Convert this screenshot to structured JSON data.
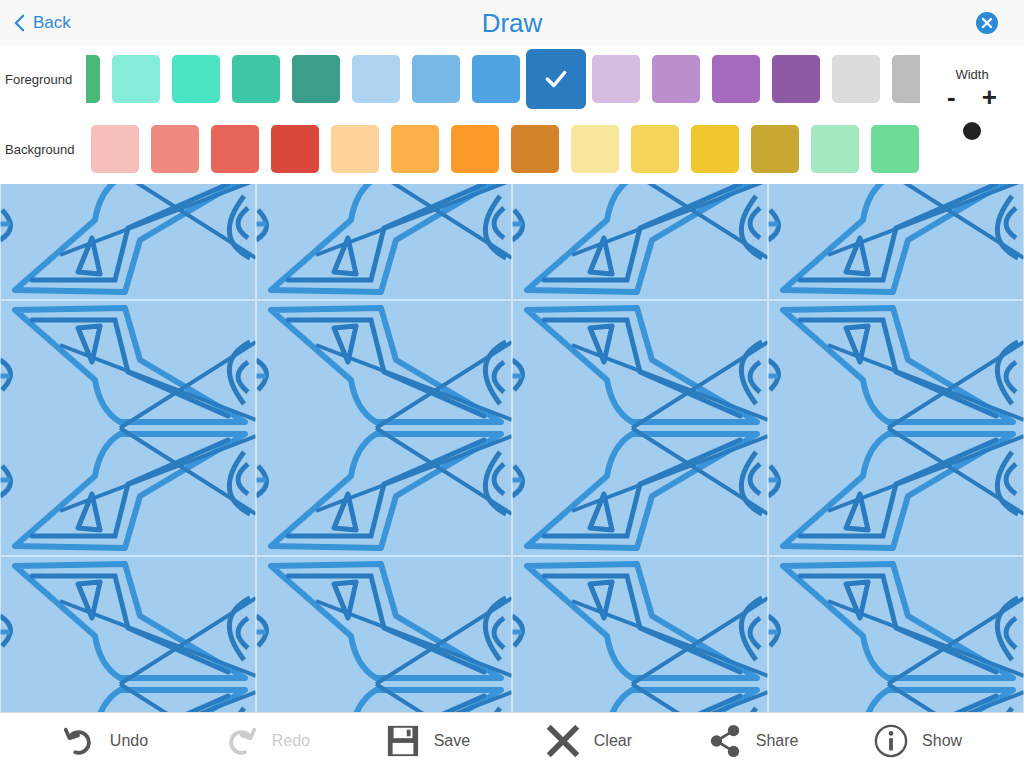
{
  "header": {
    "back": "Back",
    "title": "Draw"
  },
  "palette": {
    "foreground": {
      "label": "Foreground",
      "swatches": [
        {
          "color": "#4bb87a",
          "selected": false
        },
        {
          "color": "#84ecd8",
          "selected": false
        },
        {
          "color": "#4ae4c4",
          "selected": false
        },
        {
          "color": "#3cc6a6",
          "selected": false
        },
        {
          "color": "#3a9e8a",
          "selected": false
        },
        {
          "color": "#aed3f0",
          "selected": false
        },
        {
          "color": "#78b8e6",
          "selected": false
        },
        {
          "color": "#4fa3e0",
          "selected": false
        },
        {
          "color": "#2a7bbf",
          "selected": true
        },
        {
          "color": "#d7bde2",
          "selected": false
        },
        {
          "color": "#bb8fce",
          "selected": false
        },
        {
          "color": "#a569bd",
          "selected": false
        },
        {
          "color": "#8e5aa8",
          "selected": false
        },
        {
          "color": "#dcdcdc",
          "selected": false
        },
        {
          "color": "#bdbdbd",
          "selected": false
        }
      ]
    },
    "background": {
      "label": "Background",
      "swatches": [
        {
          "color": "#f5bfbb",
          "selected": false
        },
        {
          "color": "#ee8a80",
          "selected": false
        },
        {
          "color": "#e8655a",
          "selected": false
        },
        {
          "color": "#d9483b",
          "selected": false
        },
        {
          "color": "#fed39a",
          "selected": false
        },
        {
          "color": "#fcaf4a",
          "selected": false
        },
        {
          "color": "#fb9a28",
          "selected": false
        },
        {
          "color": "#d3822a",
          "selected": false
        },
        {
          "color": "#f8e69c",
          "selected": false
        },
        {
          "color": "#f4d55a",
          "selected": false
        },
        {
          "color": "#f0c72c",
          "selected": false
        },
        {
          "color": "#c8a832",
          "selected": false
        },
        {
          "color": "#a3e8c0",
          "selected": false
        },
        {
          "color": "#6cdc98",
          "selected": false
        }
      ]
    }
  },
  "width": {
    "label": "Width",
    "decrease": "-",
    "increase": "+"
  },
  "canvas": {
    "background": "#a3cdee",
    "strokes": [
      "#2a7bbf",
      "#3a95d8"
    ]
  },
  "toolbar": [
    {
      "label": "Undo",
      "kind": "undo",
      "disabled": false
    },
    {
      "label": "Redo",
      "kind": "redo",
      "disabled": true
    },
    {
      "label": "Save",
      "kind": "save",
      "disabled": false
    },
    {
      "label": "Clear",
      "kind": "clear",
      "disabled": false
    },
    {
      "label": "Share",
      "kind": "share",
      "disabled": false
    },
    {
      "label": "Show",
      "kind": "info",
      "disabled": false
    }
  ]
}
